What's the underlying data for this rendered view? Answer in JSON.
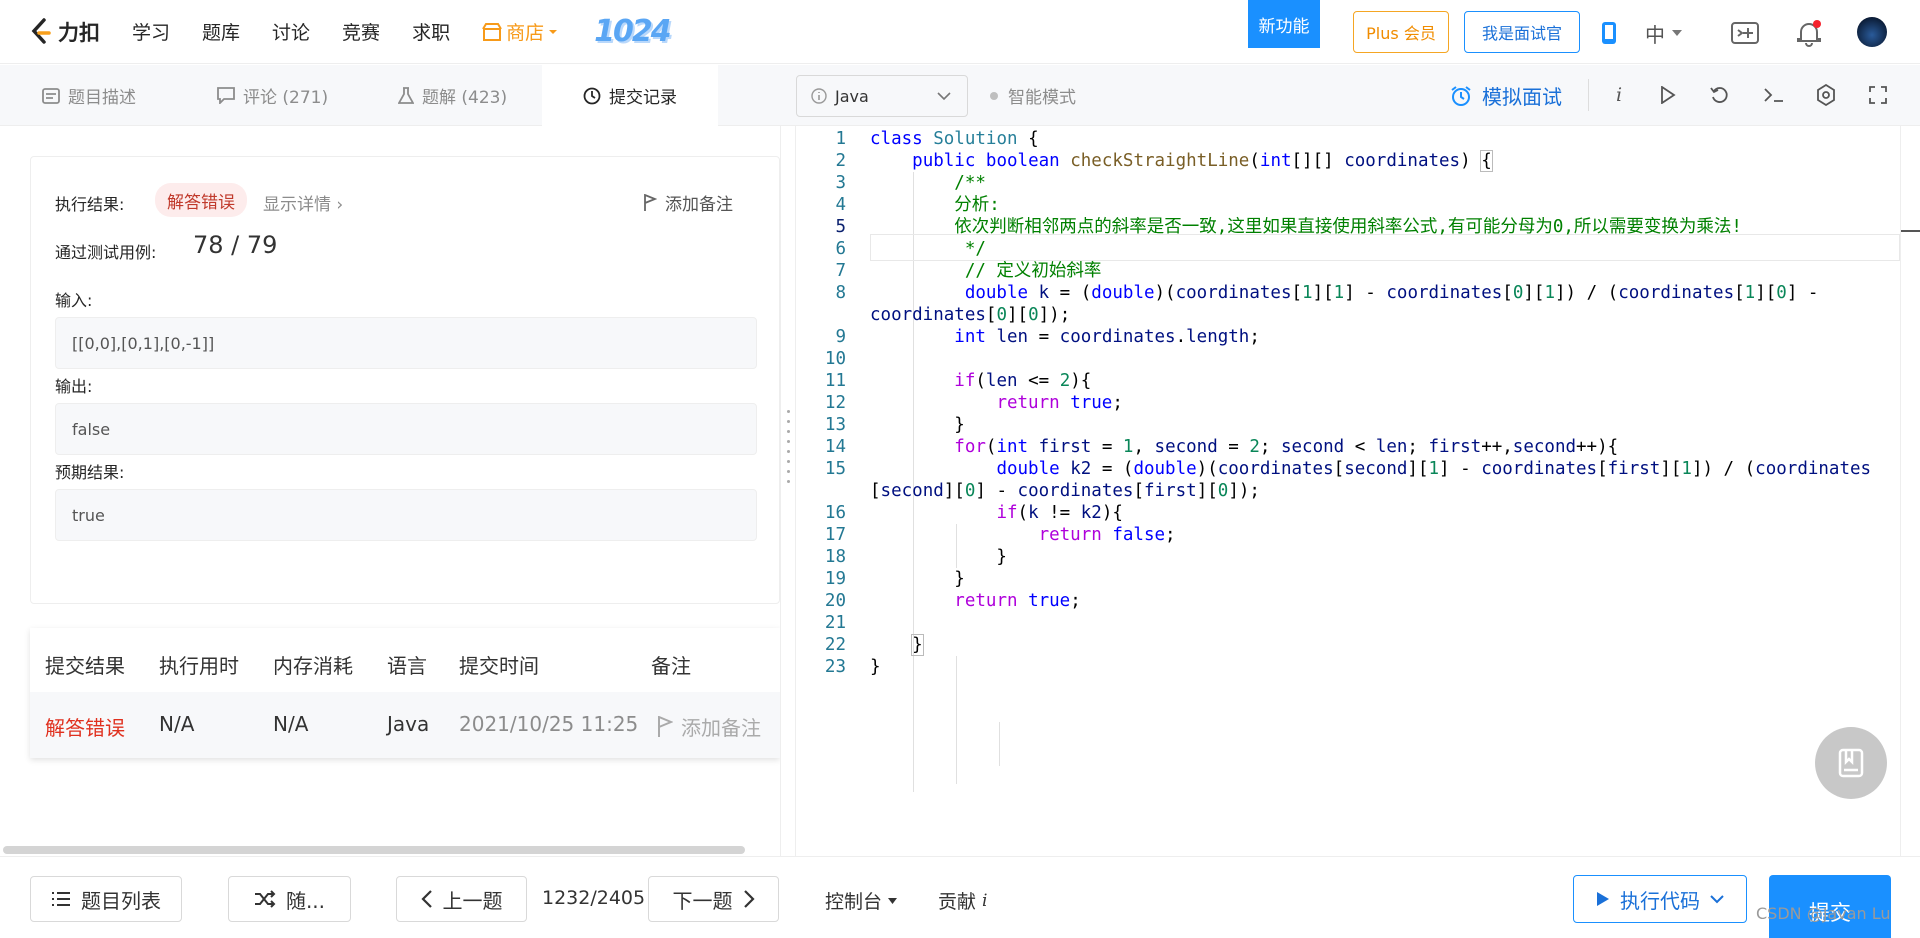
{
  "nav": {
    "logo_text": "力扣",
    "items": [
      "学习",
      "题库",
      "讨论",
      "竞赛",
      "求职"
    ],
    "shop": "商店",
    "event": "1024",
    "new_feature": "新功能",
    "plus": "Plus 会员",
    "interviewer": "我是面试官",
    "lang": "中"
  },
  "tabs": {
    "description": "题目描述",
    "comments": "评论 (271)",
    "solutions": "题解 (423)",
    "submissions": "提交记录",
    "language": "Java",
    "smart_mode": "智能模式",
    "mock_interview": "模拟面试"
  },
  "result": {
    "exec_label": "执行结果:",
    "status": "解答错误",
    "show_detail": "显示详情 ›",
    "add_note": "添加备注",
    "passed_label": "通过测试用例:",
    "passed": "78  /  79",
    "input_label": "输入:",
    "input_value": "[[0,0],[0,1],[0,-1]]",
    "output_label": "输出:",
    "output_value": "false",
    "expected_label": "预期结果:",
    "expected_value": "true"
  },
  "submissions": {
    "headers": [
      "提交结果",
      "执行用时",
      "内存消耗",
      "语言",
      "提交时间",
      "备注"
    ],
    "row": {
      "status": "解答错误",
      "runtime": "N/A",
      "memory": "N/A",
      "language": "Java",
      "time": "2021/10/25 11:25",
      "note": "添加备注"
    }
  },
  "editor": {
    "line_numbers": [
      "1",
      "2",
      "3",
      "4",
      "5",
      "6",
      "7",
      "8",
      "",
      "9",
      "10",
      "11",
      "12",
      "13",
      "14",
      "15",
      "",
      "16",
      "17",
      "18",
      "19",
      "20",
      "21",
      "22",
      "23"
    ]
  },
  "bottom": {
    "problem_list": "题目列表",
    "random": "随...",
    "prev": "上一题",
    "progress": "1232/2405",
    "next": "下一题",
    "console": "控制台",
    "contribute": "贡献",
    "run": "执行代码",
    "submit": "提交",
    "watermark": "CSDN @Javan Lu"
  },
  "colors": {
    "brand_blue": "#1a90ff",
    "shop_orange": "#f79a19",
    "error_red": "#e0301e"
  },
  "icons": [
    "search-icon",
    "comment-icon",
    "flask-icon",
    "clock-icon",
    "info-icon",
    "alarm-icon",
    "play-icon",
    "undo-icon",
    "terminal-icon",
    "settings-icon",
    "fullscreen-icon",
    "phone-icon",
    "bell-icon",
    "flag-icon",
    "list-icon",
    "shuffle-icon",
    "book-icon"
  ]
}
